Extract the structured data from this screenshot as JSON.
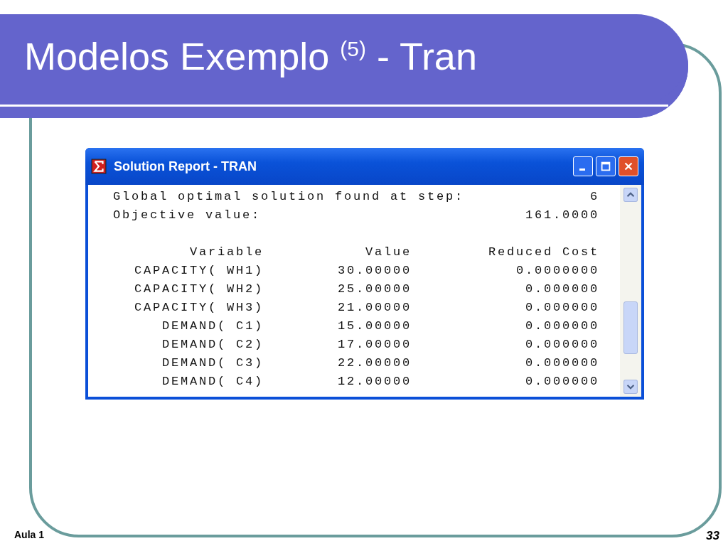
{
  "slide": {
    "title": "Modelos Exemplo $^{(5)}$ - Tran",
    "footer": "Aula 1",
    "page_number": "33"
  },
  "window": {
    "title": "Solution Report - TRAN"
  },
  "summary": [
    {
      "label": "Global optimal solution found at step:",
      "value": "6"
    },
    {
      "label": "Objective value:",
      "value": "161.0000"
    }
  ],
  "table": {
    "columns": [
      "Variable",
      "Value",
      "Reduced Cost"
    ],
    "rows": [
      [
        "CAPACITY( WH1)",
        "30.00000",
        "0.0000000"
      ],
      [
        "CAPACITY( WH2)",
        "25.00000",
        "0.000000"
      ],
      [
        "CAPACITY( WH3)",
        "21.00000",
        "0.000000"
      ],
      [
        "DEMAND( C1)",
        "15.00000",
        "0.000000"
      ],
      [
        "DEMAND( C2)",
        "17.00000",
        "0.000000"
      ],
      [
        "DEMAND( C3)",
        "22.00000",
        "0.000000"
      ],
      [
        "DEMAND( C4)",
        "12.00000",
        "0.000000"
      ]
    ]
  }
}
